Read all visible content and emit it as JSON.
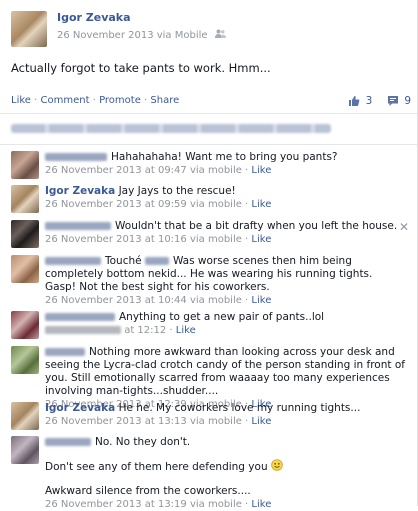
{
  "post": {
    "author": "Igor Zevaka",
    "timestamp": "26 November 2013 via Mobile",
    "text": "Actually forgot to take pants to work. Hmm...",
    "audience_icon": "people-icon"
  },
  "actions": {
    "like": "Like",
    "comment": "Comment",
    "promote": "Promote",
    "share": "Share",
    "sep": "·",
    "likes_count": "3",
    "comments_count": "9"
  },
  "comments": [
    {
      "name": "",
      "text": "Hahahahaha! Want me to bring you pants?",
      "time": "26 November 2013 at 09:47 via mobile",
      "like": "Like"
    },
    {
      "name": "Igor Zevaka",
      "text": "Jay Jays to the rescue!",
      "time": "26 November 2013 at 09:59 via mobile",
      "like": "Like"
    },
    {
      "name": "",
      "text": "Wouldn't that be a bit drafty when you left the house.",
      "time": "26 November 2013 at 10:16 via mobile",
      "like": "Like"
    },
    {
      "name": "",
      "text_pre": "Touché",
      "text": "Was worse scenes then him being completely bottom nekid... He was wearing his running tights. Gasp! Not the best sight for his coworkers.",
      "time": "26 November 2013 at 10:44 via mobile",
      "like": "Like"
    },
    {
      "name": "",
      "text": "Anything to get a new pair of pants..lol",
      "time": "at 12:12",
      "like": "Like"
    },
    {
      "name": "",
      "text": "Nothing more awkward than looking across your desk and seeing the Lycra-clad crotch candy of the person standing in front of you. Still emotionally scarred from waaaay too many experiences involving man-tights...shudder....",
      "time": "26 November 2013 at 12:39 via mobile",
      "like": "Like"
    },
    {
      "name": "Igor Zevaka",
      "text": "He he. My coworkers love my running tights...",
      "time": "26 November 2013 at 13:13 via mobile",
      "like": "Like"
    },
    {
      "name": "",
      "text": "No. No they don't.",
      "text2": "Don't see any of them here defending you",
      "text3": "Awkward silence from the coworkers....",
      "time": "26 November 2013 at 13:19 via mobile",
      "like": "Like"
    }
  ],
  "colors": {
    "link": "#3b5998",
    "meta": "#90949c"
  }
}
